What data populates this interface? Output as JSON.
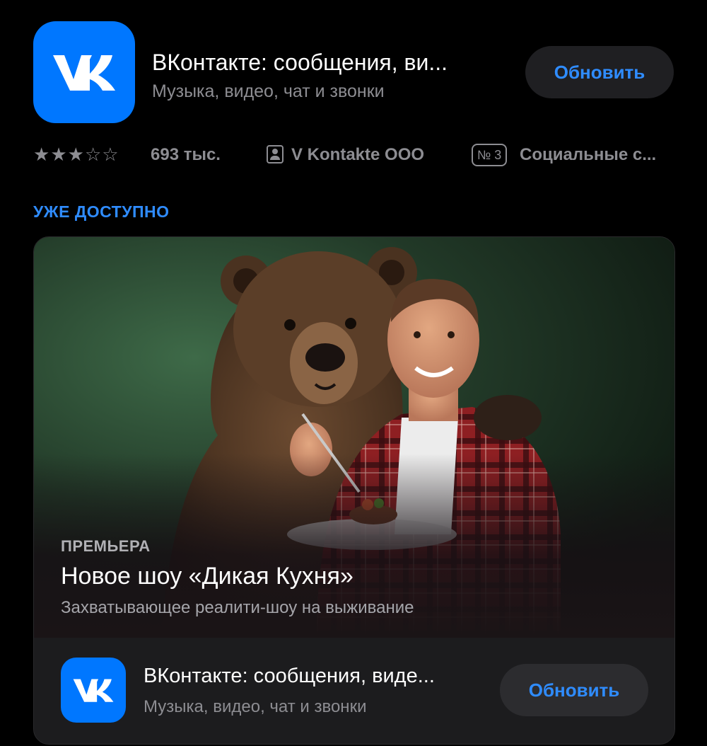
{
  "app": {
    "title": "ВКонтакте: сообщения, ви...",
    "subtitle": "Музыка, видео, чат и звонки",
    "update_label": "Обновить",
    "icon": "vk-logo-icon",
    "brand_color": "#0077ff"
  },
  "info": {
    "rating_stars": 3.5,
    "rating_max": 5,
    "rating_count": "693 тыс.",
    "developer": "V Kontakte OOO",
    "rank": "№ 3",
    "category": "Социальные с..."
  },
  "section_label": "УЖЕ ДОСТУПНО",
  "event": {
    "tag": "ПРЕМЬЕРА",
    "title": "Новое шоу «Дикая Кухня»",
    "description": "Захватывающее реалити-шоу на выживание",
    "app_title": "ВКонтакте: сообщения, виде...",
    "app_subtitle": "Музыка, видео, чат и звонки",
    "update_label": "Обновить"
  },
  "colors": {
    "accent": "#2f8cff",
    "background": "#000000",
    "card": "#1c1c1e"
  }
}
